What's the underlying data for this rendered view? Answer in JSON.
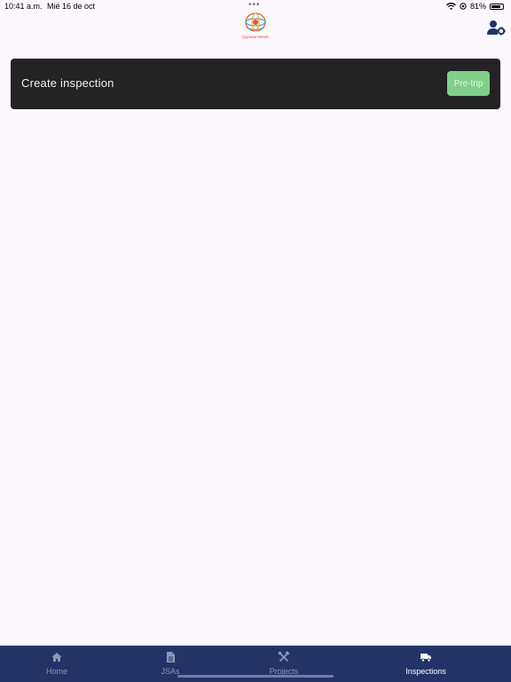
{
  "status_bar": {
    "time": "10:41 a.m.",
    "date": "Mié 16 de oct",
    "battery": "81%",
    "battery_level": 0.81
  },
  "header": {
    "logo_text": "QuantumWare",
    "settings_icon": "user-gear-icon"
  },
  "card": {
    "title": "Create inspection",
    "button_label": "Pre-trip"
  },
  "tabs": [
    {
      "label": "Home",
      "icon": "home-icon",
      "active": false
    },
    {
      "label": "JSAs",
      "icon": "document-icon",
      "active": false
    },
    {
      "label": "Projects",
      "icon": "tools-icon",
      "active": false
    },
    {
      "label": "Inspections",
      "icon": "truck-icon",
      "active": true
    }
  ],
  "colors": {
    "tab_bar": "#223467",
    "card": "#232323",
    "button": "#7fcf89",
    "background": "#fcf8fd"
  }
}
